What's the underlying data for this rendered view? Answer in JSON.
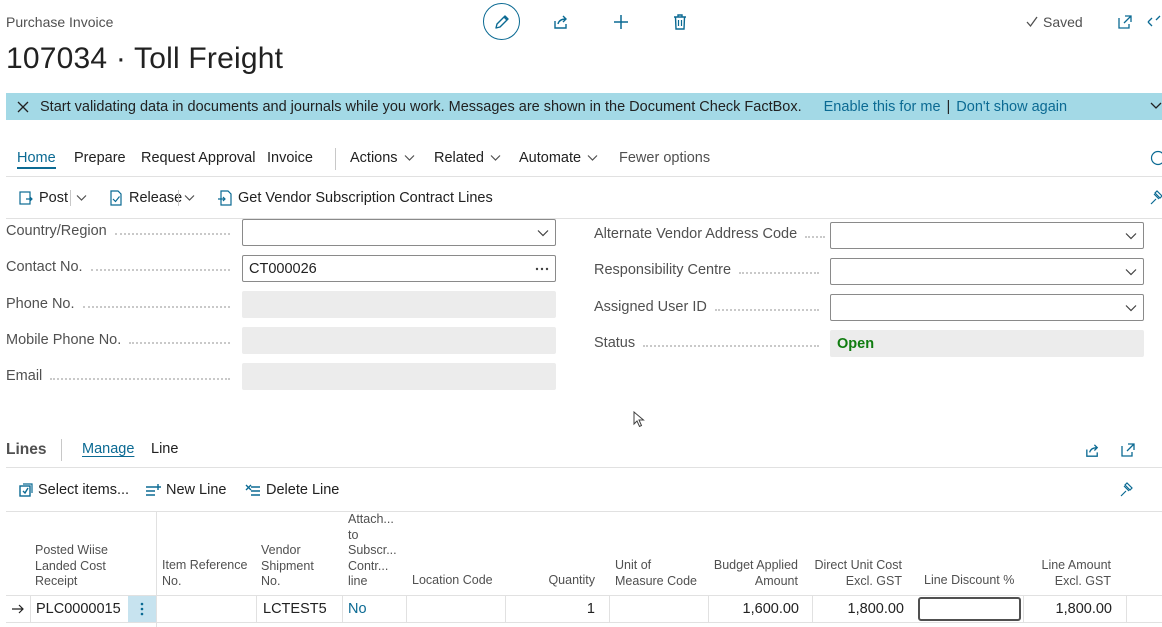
{
  "header": {
    "page_type": "Purchase Invoice",
    "title": "107034 · Toll Freight",
    "status_saved": "Saved"
  },
  "banner": {
    "message": "Start validating data in documents and journals while you work. Messages are shown in the Document Check FactBox.",
    "enable_link": "Enable this for me",
    "separator": "|",
    "dismiss_link": "Don't show again"
  },
  "actionbar": {
    "tabs": [
      "Home",
      "Prepare",
      "Request Approval",
      "Invoice"
    ],
    "menus": [
      "Actions",
      "Related",
      "Automate"
    ],
    "fewer_options": "Fewer options"
  },
  "subbar": {
    "post": "Post",
    "release": "Release",
    "get_contract_lines": "Get Vendor Subscription Contract Lines"
  },
  "fields_left": [
    {
      "label": "Country/Region",
      "value": "",
      "type": "dropdown"
    },
    {
      "label": "Contact No.",
      "value": "CT000026",
      "type": "lookup"
    },
    {
      "label": "Phone No.",
      "value": "",
      "type": "readonly"
    },
    {
      "label": "Mobile Phone No.",
      "value": "",
      "type": "readonly"
    },
    {
      "label": "Email",
      "value": "",
      "type": "readonly"
    }
  ],
  "fields_right": [
    {
      "label": "Alternate Vendor Address Code",
      "value": "",
      "type": "dropdown"
    },
    {
      "label": "Responsibility Centre",
      "value": "",
      "type": "dropdown"
    },
    {
      "label": "Assigned User ID",
      "value": "",
      "type": "dropdown"
    },
    {
      "label": "Status",
      "value": "Open",
      "type": "status"
    }
  ],
  "lines": {
    "title": "Lines",
    "tabs": [
      "Manage",
      "Line"
    ],
    "actions": {
      "select_items": "Select items...",
      "new_line": "New Line",
      "delete_line": "Delete Line"
    },
    "columns": {
      "posted_lc": [
        "Posted Wiise",
        "Landed Cost",
        "Receipt"
      ],
      "item_ref": [
        "Item Reference",
        "No."
      ],
      "vendor_ship": [
        "Vendor",
        "Shipment",
        "No."
      ],
      "attach": [
        "Attach...",
        "to",
        "Subscr...",
        "Contr...",
        "line"
      ],
      "location": [
        "Location Code"
      ],
      "quantity": [
        "Quantity"
      ],
      "uom": [
        "Unit of",
        "Measure Code"
      ],
      "budget": [
        "Budget Applied",
        "Amount"
      ],
      "direct_cost": [
        "Direct Unit Cost",
        "Excl. GST"
      ],
      "line_discount": [
        "Line Discount %"
      ],
      "line_amount": [
        "Line Amount",
        "Excl. GST"
      ]
    },
    "row": {
      "posted_lc": "PLC0000015",
      "item_ref": "",
      "vendor_ship": "LCTEST5",
      "attach": "No",
      "location": "",
      "quantity": "1",
      "uom": "",
      "budget": "1,600.00",
      "direct_cost": "1,800.00",
      "line_discount": "",
      "line_amount": "1,800.00"
    }
  },
  "colors": {
    "accent": "#0b6a93",
    "banner_bg": "#a3d9e6",
    "status_open": "#107c10"
  }
}
